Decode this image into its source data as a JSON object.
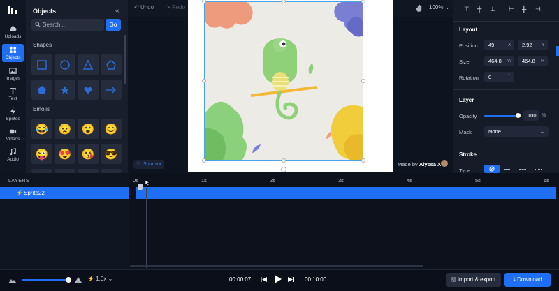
{
  "sidebar": {
    "items": [
      {
        "label": "Uploads",
        "icon": "cloud-upload-icon"
      },
      {
        "label": "Objects",
        "icon": "objects-icon"
      },
      {
        "label": "Images",
        "icon": "image-icon"
      },
      {
        "label": "Text",
        "icon": "text-icon"
      },
      {
        "label": "Sprites",
        "icon": "lightning-icon"
      },
      {
        "label": "Videos",
        "icon": "video-icon"
      },
      {
        "label": "Audio",
        "icon": "music-icon"
      }
    ]
  },
  "panel": {
    "title": "Objects",
    "search_placeholder": "Search...",
    "go_label": "Go",
    "shapes_label": "Shapes",
    "emojis_label": "Emojis",
    "emojis": [
      "😂",
      "😟",
      "😮",
      "😊",
      "😜",
      "😍",
      "😘",
      "😎"
    ]
  },
  "toolbar": {
    "undo": "Undo",
    "redo": "Redo",
    "zoom": "100%"
  },
  "canvas": {
    "sponsor": "Sponsor",
    "made_by": "Made by",
    "author": "Alyssa X"
  },
  "properties": {
    "layout_title": "Layout",
    "position_label": "Position",
    "pos_x": "49",
    "pos_x_unit": "X",
    "pos_y": "2.92",
    "pos_y_unit": "Y",
    "size_label": "Size",
    "width": "464.8",
    "width_unit": "W",
    "height": "464.8",
    "height_unit": "H",
    "rotation_label": "Rotation",
    "rotation": "0",
    "rotation_unit": "°",
    "layer_title": "Layer",
    "opacity_label": "Opacity",
    "opacity": "100",
    "opacity_unit": "%",
    "mask_label": "Mask",
    "mask": "None",
    "stroke_title": "Stroke",
    "type_label": "Type"
  },
  "timeline": {
    "layers_label": "LAYERS",
    "layer_name": "Sprite22",
    "ticks": [
      "0s",
      "1s",
      "2s",
      "3s",
      "4s",
      "5s",
      "6s"
    ]
  },
  "bottom": {
    "speed": "1.0x",
    "current_time": "00:00:07",
    "total_time": "00:10:00",
    "import_export": "Import & export",
    "download": "Download"
  },
  "colors": {
    "accent": "#1e6ff2",
    "background": "#0e1320"
  }
}
